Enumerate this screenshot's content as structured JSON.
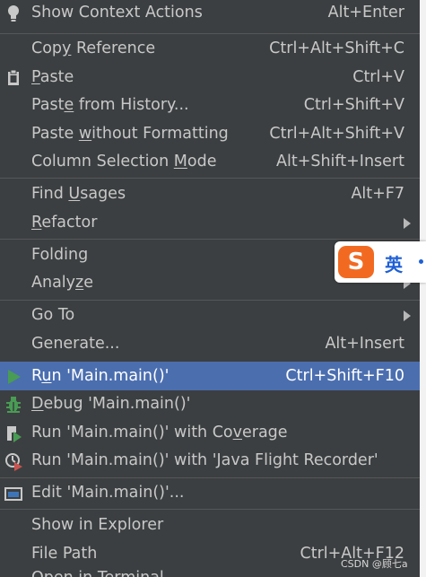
{
  "menu": {
    "show_context_actions": {
      "label": "Show Context Actions",
      "shortcut": "Alt+Enter"
    },
    "copy_reference": {
      "pre": "Cop",
      "mn": "y",
      "post": " Reference",
      "shortcut": "Ctrl+Alt+Shift+C"
    },
    "paste": {
      "pre": "",
      "mn": "P",
      "post": "aste",
      "shortcut": "Ctrl+V"
    },
    "paste_from_history": {
      "pre": "Past",
      "mn": "e",
      "post": " from History...",
      "shortcut": "Ctrl+Shift+V"
    },
    "paste_without_formatting": {
      "pre": "Paste ",
      "mn": "w",
      "post": "ithout Formatting",
      "shortcut": "Ctrl+Alt+Shift+V"
    },
    "column_selection_mode": {
      "pre": "Column Selection ",
      "mn": "M",
      "post": "ode",
      "shortcut": "Alt+Shift+Insert"
    },
    "find_usages": {
      "pre": "Find ",
      "mn": "U",
      "post": "sages",
      "shortcut": "Alt+F7"
    },
    "refactor": {
      "pre": "",
      "mn": "R",
      "post": "efactor"
    },
    "folding": {
      "label": "Folding"
    },
    "analyze": {
      "pre": "Analy",
      "mn": "z",
      "post": "e"
    },
    "go_to": {
      "label": "Go To"
    },
    "generate": {
      "label": "Generate...",
      "shortcut": "Alt+Insert"
    },
    "run": {
      "pre": "R",
      "mn": "u",
      "post": "n 'Main.main()'",
      "shortcut": "Ctrl+Shift+F10"
    },
    "debug": {
      "pre": "",
      "mn": "D",
      "post": "ebug 'Main.main()'"
    },
    "run_coverage": {
      "pre": "Run 'Main.main()' with Co",
      "mn": "v",
      "post": "erage"
    },
    "run_jfr": {
      "label": "Run 'Main.main()' with 'Java Flight Recorder'"
    },
    "edit_config": {
      "label": "Edit 'Main.main()'..."
    },
    "show_in_explorer": {
      "label": "Show in Explorer"
    },
    "file_path": {
      "label": "File Path",
      "shortcut": "Ctrl+Alt+F12"
    },
    "open_in_terminal": {
      "label": "Open in Terminal"
    }
  },
  "ime": {
    "logo": "S",
    "lang": "英"
  },
  "watermark": "CSDN @顾七a",
  "colors": {
    "background": "#3c3f41",
    "selection": "#4b6eaf",
    "text": "#c8c8c8",
    "run_green": "#499c54",
    "debug_red": "#c75450"
  },
  "icons": [
    "bulb-icon",
    "clipboard-icon",
    "run-icon",
    "bug-icon",
    "coverage-icon",
    "flight-recorder-icon",
    "edit-config-icon"
  ]
}
